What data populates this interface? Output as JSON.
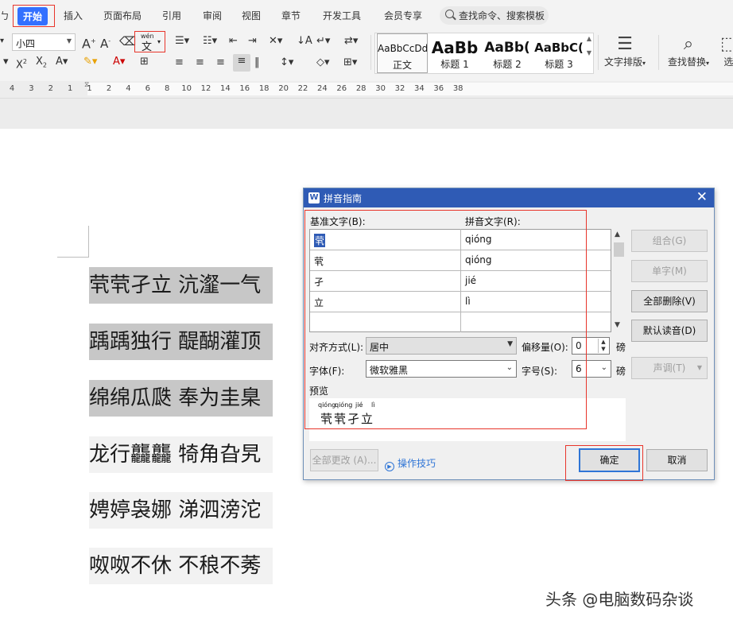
{
  "ribbon": {
    "partial_tab": "ㄅ",
    "tabs": [
      "开始",
      "插入",
      "页面布局",
      "引用",
      "审阅",
      "视图",
      "章节",
      "开发工具",
      "会员专享"
    ],
    "search_placeholder": "查找命令、搜索模板"
  },
  "toolbar": {
    "font_size": "小四",
    "pinyin_icon_top": "wén",
    "pinyin_icon_char": "文",
    "styles": [
      {
        "sample": "AaBbCcDd",
        "name": "正文"
      },
      {
        "sample": "AaBb",
        "name": "标题 1"
      },
      {
        "sample": "AaBb(",
        "name": "标题 2"
      },
      {
        "sample": "AaBbC(",
        "name": "标题 3"
      }
    ],
    "text_layout_label": "文字排版",
    "find_replace_label": "查找替换",
    "select_label": "选"
  },
  "ruler": {
    "numbers": [
      "4",
      "3",
      "2",
      "1",
      "1",
      "2",
      "4",
      "6",
      "8",
      "10",
      "12",
      "14",
      "16",
      "18",
      "20",
      "22",
      "24",
      "26",
      "28",
      "30",
      "32",
      "34",
      "36",
      "38"
    ]
  },
  "document": {
    "lines": [
      "茕茕孑立 沆瀣一气",
      "踽踽独行 醍醐灌顶",
      "绵绵瓜瓞 奉为圭臬",
      "龙行龘龘 犄角旮旯",
      "娉婷袅娜 涕泗滂沱",
      "呶呶不休 不稂不莠"
    ]
  },
  "dialog": {
    "title": "拼音指南",
    "base_text_label": "基准文字(B):",
    "pinyin_text_label": "拼音文字(R):",
    "rows": [
      {
        "base": "茕",
        "pinyin": "qióng"
      },
      {
        "base": "茕",
        "pinyin": "qióng"
      },
      {
        "base": "孑",
        "pinyin": "jié"
      },
      {
        "base": "立",
        "pinyin": "lì"
      },
      {
        "base": "",
        "pinyin": ""
      }
    ],
    "buttons": {
      "combine": "组合(G)",
      "single": "单字(M)",
      "delete_all": "全部删除(V)",
      "default_reading": "默认读音(D)",
      "tone": "声调(T)",
      "change_all": "全部更改 (A)...",
      "ok": "确定",
      "cancel": "取消"
    },
    "alignment_label": "对齐方式(L):",
    "alignment_value": "居中",
    "offset_label": "偏移量(O):",
    "offset_value": "0",
    "offset_unit": "磅",
    "font_label": "字体(F):",
    "font_value": "微软雅黑",
    "size_label": "字号(S):",
    "size_value": "6",
    "size_unit": "磅",
    "preview_label": "预览",
    "preview_pinyin": [
      "qióng",
      "qióng",
      "jié",
      "lì"
    ],
    "preview_text": "茕茕孑立",
    "tips_label": "操作技巧"
  },
  "watermark": "头条 @电脑数码杂谈",
  "colors": {
    "accent": "#3370ff",
    "dialog_title_bar": "#2f5bb5",
    "highlight_box": "#e8352b"
  }
}
